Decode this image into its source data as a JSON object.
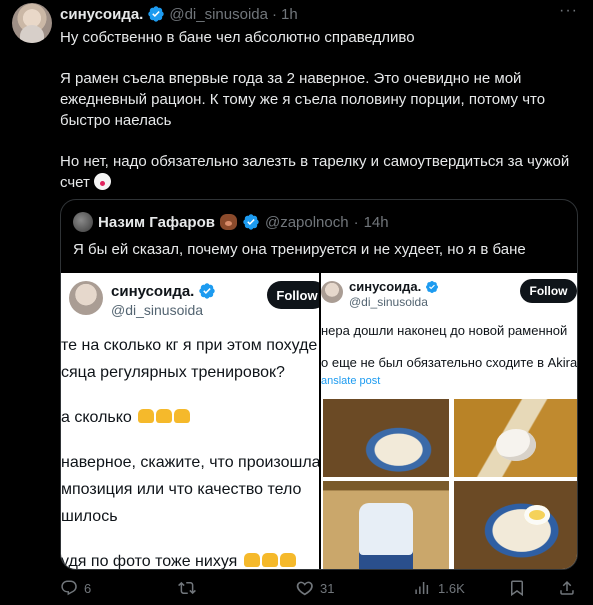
{
  "author": {
    "name": "синусоида.",
    "handle": "@di_sinusoida",
    "separator": "·",
    "time": "1h"
  },
  "tweet": {
    "line1": "Ну собственно в бане чел абсолютно справедливо",
    "para2": "Я рамен съела впервые года за 2 наверное. Это очевидно не мой ежедневный рацион. К тому же я съела половину порции, потому что быстро наелась",
    "para3": "Но нет, надо обязательно залезть в тарелку и самоутвердиться за чужой счет"
  },
  "quote": {
    "name": "Назим Гафаров",
    "handle": "@zapolnoch",
    "separator": "·",
    "time": "14h",
    "text": "Я бы ей сказал, почему она тренируется и не худеет, но я в бане"
  },
  "screenshot_left": {
    "name": "синусоида.",
    "handle": "@di_sinusoida",
    "follow": "Follow",
    "line1": "те на сколько кг я при этом похуде",
    "line2": "сяца регулярных тренировок?",
    "line3": "а сколько",
    "line4": "наверное, скажите, что произошла",
    "line5": "мпозиция или что качество тело",
    "line6": "шилось",
    "line7": "удя по фото тоже нихуя"
  },
  "screenshot_right": {
    "name": "синусоида.",
    "handle": "@di_sinusoida",
    "follow": "Follow",
    "line1": "нера дошли наконец до новой раменной",
    "line2": "о еще не был обязательно сходите в Akira",
    "translate": "anslate post"
  },
  "actions": {
    "replies": "6",
    "reposts": "",
    "likes": "31",
    "views": "1.6K"
  },
  "colors": {
    "background": "#000000",
    "text": "#e7e9ea",
    "muted": "#71767b",
    "verified": "#1d9bf0",
    "border": "#2f3336"
  }
}
